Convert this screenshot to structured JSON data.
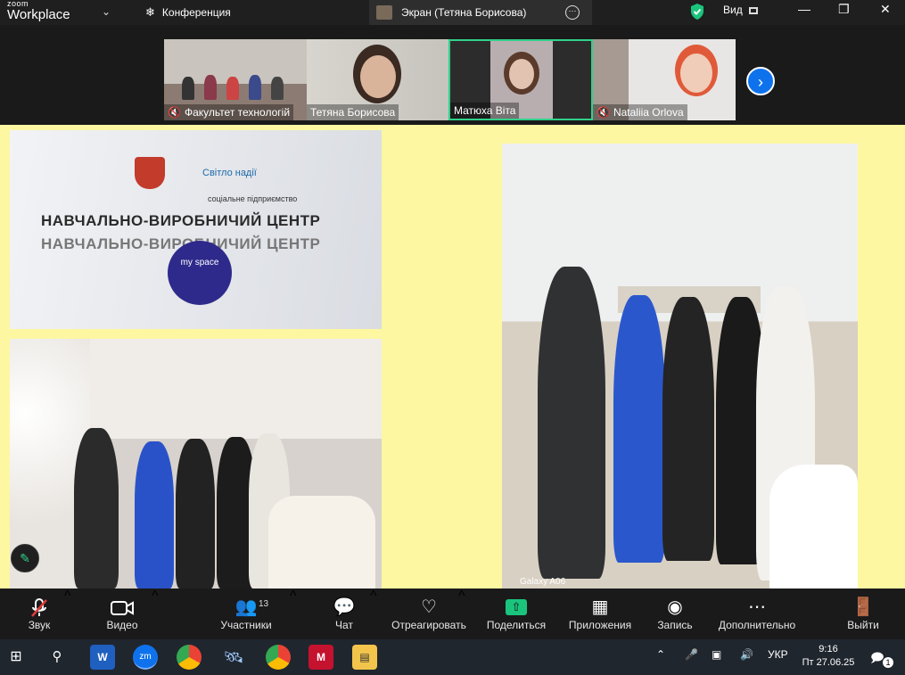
{
  "app": {
    "brand_top": "zoom",
    "brand_bottom": "Workplace"
  },
  "titlebar": {
    "conference_label": "Конференция",
    "screen_tab_label": "Экран (Тетяна Борисова)",
    "view_label": "Вид"
  },
  "participants_strip": [
    {
      "name": "Факультет технологій",
      "muted": true
    },
    {
      "name": "Тетяна Борисова",
      "muted": false
    },
    {
      "name": "Матюха Віта",
      "muted": false,
      "active_speaker": true
    },
    {
      "name": "Nataliia Orlova",
      "muted": true
    }
  ],
  "shared_screen": {
    "background_color": "#fdf7a1",
    "sign": {
      "line1": "НАВЧАЛЬНО-ВИРОБНИЧИЙ ЦЕНТР",
      "line2": "НАВЧАЛЬНО-ВИРОБНИЧИЙ ЦЕНТР",
      "brand": "Світло надії",
      "subtitle": "соціальне підприємство",
      "badge": "my space"
    },
    "photo_caption": "Galaxy A06"
  },
  "toolbar": {
    "audio": "Звук",
    "video": "Видео",
    "participants": "Участники",
    "participants_count": "13",
    "chat": "Чат",
    "react": "Отреагировать",
    "share": "Поделиться",
    "apps": "Приложения",
    "record": "Запись",
    "more": "Дополнительно",
    "leave": "Выйти"
  },
  "taskbar": {
    "language": "УКР",
    "time": "9:16",
    "date": "Пт 27.06.25",
    "notifications": "1"
  },
  "colors": {
    "accent": "#0e72ed",
    "active_border": "#2fd18b",
    "share_green": "#1bc47d",
    "muted_red": "#e03a3a"
  }
}
